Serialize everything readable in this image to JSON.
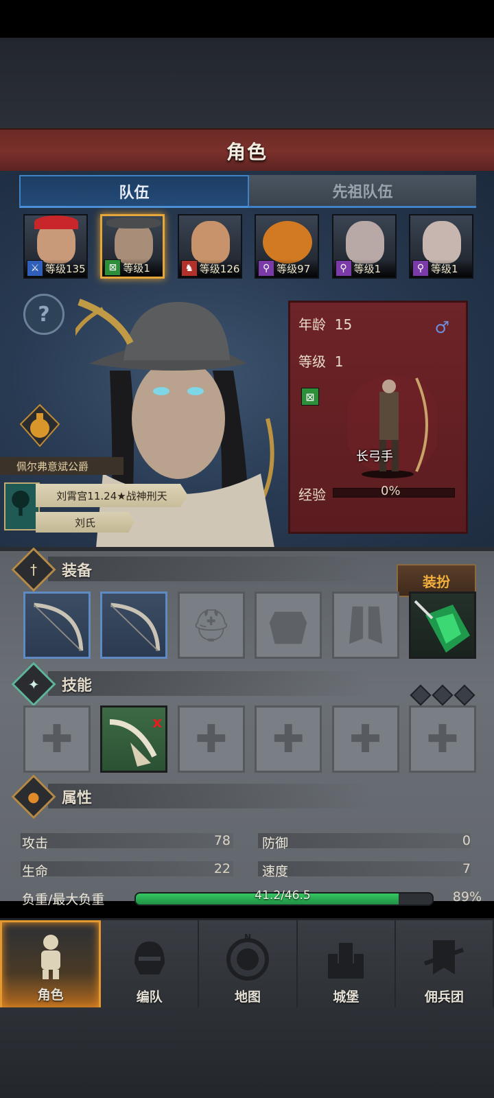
{
  "header": {
    "title": "角色"
  },
  "tabs": [
    {
      "label": "队伍",
      "active": true
    },
    {
      "label": "先祖队伍",
      "active": false
    }
  ],
  "party": [
    {
      "level_text": "等级135",
      "class_icon": "sword-icon",
      "badge_color": "#2f5fb8",
      "face_color": "#c99a7a",
      "selected": false
    },
    {
      "level_text": "等级1",
      "class_icon": "bow-icon",
      "badge_color": "#2e8f3a",
      "face_color": "#a88d78",
      "selected": true
    },
    {
      "level_text": "等级126",
      "class_icon": "horse-icon",
      "badge_color": "#b2322b",
      "face_color": "#c8936a",
      "selected": false
    },
    {
      "level_text": "等级97",
      "class_icon": "staff-icon",
      "badge_color": "#7a3aa8",
      "face_color": "#d27a22",
      "selected": false
    },
    {
      "level_text": "等级1",
      "class_icon": "staff-icon",
      "badge_color": "#7a3aa8",
      "face_color": "#b8a9a6",
      "selected": false
    },
    {
      "level_text": "等级1",
      "class_icon": "staff-icon",
      "badge_color": "#7a3aa8",
      "face_color": "#c7b6b0",
      "selected": false
    }
  ],
  "character": {
    "house_title": "佩尔弗意斌公爵",
    "name": "刘霄宫11.24★战神刑天",
    "family": "刘氏",
    "age_label": "年龄",
    "age": "15",
    "level_label": "等级",
    "level": "1",
    "class_name": "长弓手",
    "xp_label": "经验",
    "xp_text": "0%",
    "xp_fraction": 0
  },
  "equipment": {
    "title": "装备",
    "outfit_label": "装扮",
    "slots": [
      "bow-icon",
      "bow-icon",
      "helmet-icon",
      "armor-icon",
      "boots-icon",
      "emerald-amulet-icon"
    ]
  },
  "skills": {
    "title": "技能",
    "slots": [
      "empty",
      "arrow-skill-icon",
      "empty",
      "empty",
      "empty",
      "empty"
    ]
  },
  "attributes": {
    "title": "属性",
    "attack_label": "攻击",
    "attack": "78",
    "defense_label": "防御",
    "defense": "0",
    "hp_label": "生命",
    "hp": "22",
    "speed_label": "速度",
    "speed": "7",
    "load_label": "负重/最大负重",
    "load_text": "41.2/46.5",
    "load_percent": "89%",
    "load_fraction": 0.886
  },
  "nav": [
    {
      "label": "角色",
      "icon": "knight-icon",
      "active": true
    },
    {
      "label": "编队",
      "icon": "helmet-icon",
      "active": false
    },
    {
      "label": "地图",
      "icon": "compass-map-icon",
      "active": false
    },
    {
      "label": "城堡",
      "icon": "castle-icon",
      "active": false
    },
    {
      "label": "佣兵团",
      "icon": "mercenary-icon",
      "active": false
    }
  ]
}
